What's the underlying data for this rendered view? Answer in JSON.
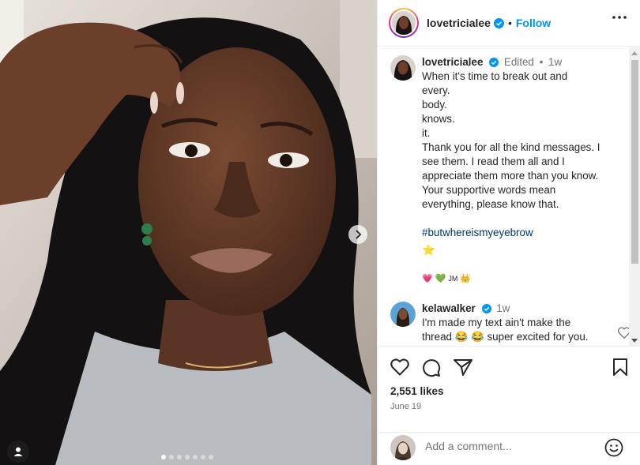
{
  "post": {
    "author": "lovetricialee",
    "follow_label": "Follow",
    "separator": "•"
  },
  "caption": {
    "username": "lovetricialee",
    "edited": "Edited",
    "dot": "•",
    "time": "1w",
    "lines": [
      "When it's time to break out and",
      "every.",
      "body.",
      "knows.",
      "it.",
      "Thank you for all the kind messages. I",
      "see them. I read them all and I",
      "appreciate them more than you know.",
      "Your supportive words mean",
      "everything, please know that."
    ],
    "hashtag": "#butwhereismyeyebrow",
    "emoji_star": "⭐",
    "emoji_row": [
      "💗",
      "💚"
    ],
    "emoji_row_text": "JM",
    "emoji_crown": "👑"
  },
  "comment": {
    "username": "kelawalker",
    "time": "1w",
    "text_1": "I'm made my text ain't make the",
    "text_2": "thread 😂 😂 super excited for you."
  },
  "stats": {
    "likes": "2,551 likes",
    "date": "June 19"
  },
  "add_comment": {
    "placeholder": "Add a comment..."
  },
  "carousel": {
    "total": 7,
    "active": 1
  },
  "icons": {
    "verified": "verified-badge-icon",
    "more": "more-horizontal-icon",
    "like": "heart-icon",
    "comment": "comment-icon",
    "share": "send-icon",
    "save": "bookmark-icon",
    "emoji": "smiley-icon",
    "next": "chevron-right-icon",
    "tag": "user-tag-icon"
  },
  "colors": {
    "follow": "#0095f6",
    "verified": "#0095f6",
    "hashtag": "#00376b",
    "meta": "#737373"
  }
}
